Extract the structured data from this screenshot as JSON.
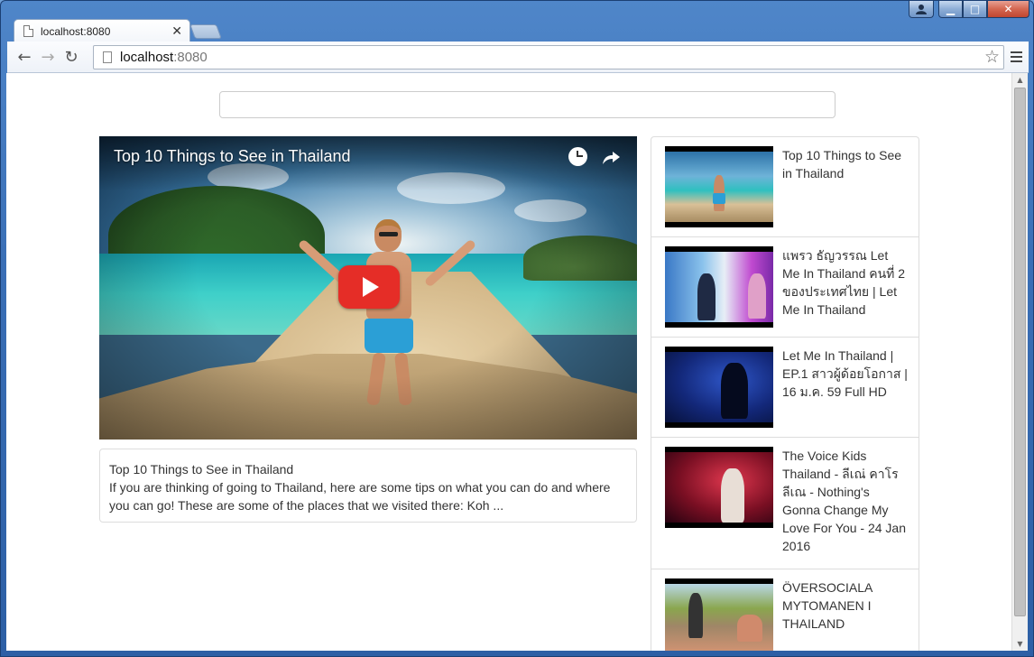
{
  "browser": {
    "tab_title": "localhost:8080",
    "tab_close": "✕",
    "address_host": "localhost",
    "address_port": ":8080",
    "back_icon": "←",
    "forward_icon": "→",
    "reload_icon": "↻",
    "star_icon": "☆",
    "caption_min": "▁",
    "caption_max": "□",
    "caption_close": "✕"
  },
  "search": {
    "value": "",
    "placeholder": ""
  },
  "player": {
    "title": "Top 10 Things to See in Thailand"
  },
  "description": {
    "title": "Top 10 Things to See in Thailand",
    "text": "If you are thinking of going to Thailand, here are some tips on what you can do and where you can go! These are some of the places that we visited there: Koh ..."
  },
  "videos": [
    {
      "title": "Top 10 Things to See in Thailand"
    },
    {
      "title": "แพรว ธัญวรรณ Let Me In Thailand คนที่ 2 ของประเทศไทย | Let Me In Thailand"
    },
    {
      "title": "Let Me In Thailand | EP.1 สาวผู้ด้อยโอกาส | 16 ม.ค. 59 Full HD"
    },
    {
      "title": "The Voice Kids Thailand - ลีเณ่ คาโรลีเณ - Nothing's Gonna Change My Love For You - 24 Jan 2016"
    },
    {
      "title": "ÖVERSOCIALA MYTOMANEN I THAILAND"
    }
  ],
  "scrollbar": {
    "up_icon": "▲",
    "down_icon": "▼"
  }
}
